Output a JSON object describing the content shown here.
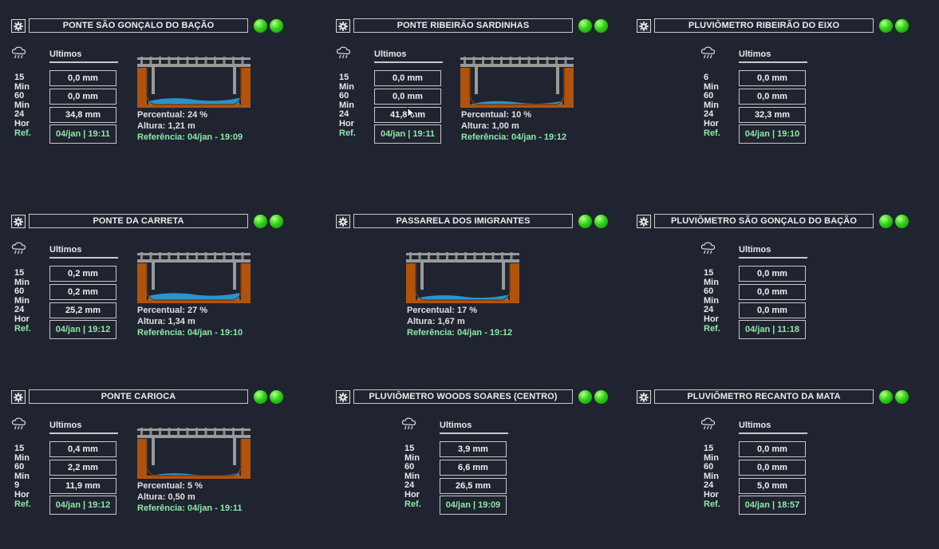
{
  "colors": {
    "background": "#202430",
    "led": "#35d11c",
    "ref_text": "#8ee8a8",
    "soil": "#b0530f",
    "water": "#2a9ad8",
    "bridge": "#8c8c8c"
  },
  "icons": {
    "settings": "gear-icon",
    "rain": "rain-cloud-icon",
    "status": "green-led-icon"
  },
  "rain_header": "Ultimos",
  "ref_label": "Ref.",
  "stations": [
    {
      "title": "PONTE SÃO GONÇALO DO BAÇÃO",
      "rows": [
        {
          "label": "15 Min",
          "value": "0,0 mm"
        },
        {
          "label": "60 Min",
          "value": "0,0 mm"
        },
        {
          "label": "24 Hor",
          "value": "34,8 mm"
        }
      ],
      "ref": "04/jan | 19:11",
      "bridge": {
        "level_fraction": 0.24,
        "percentual": "Percentual: 24 %",
        "altura": "Altura: 1,21 m",
        "referencia": "Referência:  04/jan - 19:09"
      }
    },
    {
      "title": "PONTE RIBEIRÃO SARDINHAS",
      "rows": [
        {
          "label": "15 Min",
          "value": "0,0 mm"
        },
        {
          "label": "60 Min",
          "value": "0,0 mm"
        },
        {
          "label": "24 Hor",
          "value": "41,8 mm"
        }
      ],
      "ref": "04/jan | 19:11",
      "bridge": {
        "level_fraction": 0.1,
        "percentual": "Percentual: 10 %",
        "altura": "Altura: 1,00 m",
        "referencia": "Referência:  04/jan - 19:12"
      }
    },
    {
      "title": "PLUVIÔMETRO RIBEIRÃO DO EIXO",
      "rows": [
        {
          "label": "6 Min",
          "value": "0,0 mm"
        },
        {
          "label": "60 Min",
          "value": "0,0 mm"
        },
        {
          "label": "24 Hor",
          "value": "32,3 mm"
        }
      ],
      "ref": "04/jan | 19:10"
    },
    {
      "title": "PONTE DA CARRETA",
      "rows": [
        {
          "label": "15 Min",
          "value": "0,2 mm"
        },
        {
          "label": "60 Min",
          "value": "0,2 mm"
        },
        {
          "label": "24 Hor",
          "value": "25,2 mm"
        }
      ],
      "ref": "04/jan | 19:12",
      "bridge": {
        "level_fraction": 0.27,
        "percentual": "Percentual: 27 %",
        "altura": "Altura: 1,34 m",
        "referencia": "Referência:  04/jan - 19:10"
      }
    },
    {
      "title": "PASSARELA DOS IMIGRANTES",
      "bridge": {
        "level_fraction": 0.17,
        "percentual": "Percentual: 17 %",
        "altura": "Altura: 1,67 m",
        "referencia": "Referência:  04/jan - 19:12"
      }
    },
    {
      "title": "PLUVIÔMETRO SÃO GONÇALO DO BAÇÃO",
      "rows": [
        {
          "label": "15 Min",
          "value": "0,0 mm"
        },
        {
          "label": "60 Min",
          "value": "0,0 mm"
        },
        {
          "label": "24 Hor",
          "value": "0,0 mm"
        }
      ],
      "ref": "04/jan | 11:18"
    },
    {
      "title": "PONTE CARIOCA",
      "rows": [
        {
          "label": "15 Min",
          "value": "0,4 mm"
        },
        {
          "label": "60 Min",
          "value": "2,2 mm"
        },
        {
          "label": "9 Hor",
          "value": "11,9 mm"
        }
      ],
      "ref": "04/jan | 19:12",
      "bridge": {
        "level_fraction": 0.05,
        "percentual": "Percentual: 5 %",
        "altura": "Altura: 0,50 m",
        "referencia": "Referência:  04/jan - 19:11"
      }
    },
    {
      "title": "PLUVIÔMETRO WOODS SOARES (CENTRO)",
      "rows": [
        {
          "label": "15 Min",
          "value": "3,9 mm"
        },
        {
          "label": "60 Min",
          "value": "6,6 mm"
        },
        {
          "label": "24 Hor",
          "value": "26,5 mm"
        }
      ],
      "ref": "04/jan | 19:09"
    },
    {
      "title": "PLUVIÔMETRO RECANTO DA MATA",
      "rows": [
        {
          "label": "15 Min",
          "value": "0,0 mm"
        },
        {
          "label": "60 Min",
          "value": "0,0 mm"
        },
        {
          "label": "24 Hor",
          "value": "5,0 mm"
        }
      ],
      "ref": "04/jan | 18:57"
    }
  ]
}
